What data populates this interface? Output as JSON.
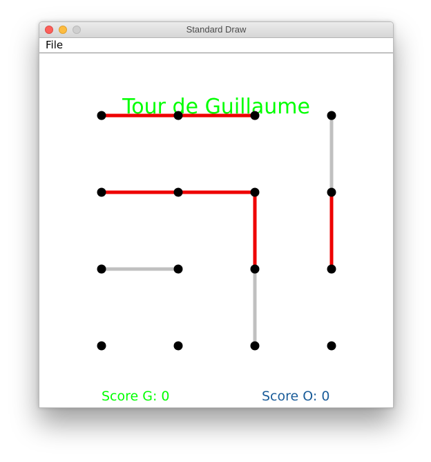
{
  "window": {
    "title": "Standard Draw",
    "menu": [
      "File"
    ]
  },
  "game": {
    "title": "Tour de Guillaume",
    "grid": {
      "columns": 4,
      "rows": 4
    },
    "edges": [
      {
        "from": [
          0,
          0
        ],
        "to": [
          1,
          0
        ],
        "state": "red"
      },
      {
        "from": [
          1,
          0
        ],
        "to": [
          2,
          0
        ],
        "state": "red"
      },
      {
        "from": [
          3,
          0
        ],
        "to": [
          3,
          1
        ],
        "state": "gray"
      },
      {
        "from": [
          0,
          1
        ],
        "to": [
          1,
          1
        ],
        "state": "red"
      },
      {
        "from": [
          1,
          1
        ],
        "to": [
          2,
          1
        ],
        "state": "red"
      },
      {
        "from": [
          2,
          1
        ],
        "to": [
          2,
          2
        ],
        "state": "red"
      },
      {
        "from": [
          3,
          1
        ],
        "to": [
          3,
          2
        ],
        "state": "red"
      },
      {
        "from": [
          0,
          2
        ],
        "to": [
          1,
          2
        ],
        "state": "gray"
      },
      {
        "from": [
          2,
          2
        ],
        "to": [
          2,
          3
        ],
        "state": "gray"
      }
    ],
    "colors": {
      "red": "#ee0000",
      "gray": "#c0c0c0",
      "dot": "#000000",
      "title": "#00ff00",
      "score_g": "#00ff00",
      "score_o": "#1a5c99"
    },
    "score_g": "Score G: 0",
    "score_o": "Score O: 0"
  }
}
